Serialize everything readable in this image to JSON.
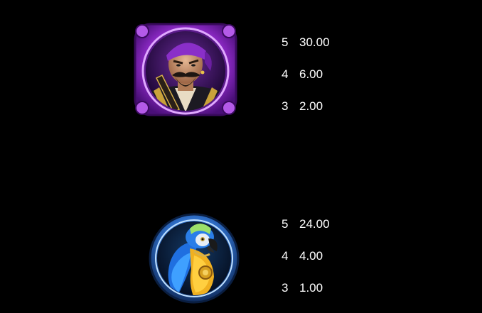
{
  "background_color": "#000000",
  "symbols": [
    {
      "icon": "pirate-icon",
      "frame_color": "#9b2fd6",
      "payouts": [
        {
          "count": "5",
          "value": "30.00"
        },
        {
          "count": "4",
          "value": "6.00"
        },
        {
          "count": "3",
          "value": "2.00"
        }
      ]
    },
    {
      "icon": "parrot-icon",
      "frame_color": "#2f6fc9",
      "payouts": [
        {
          "count": "5",
          "value": "24.00"
        },
        {
          "count": "4",
          "value": "4.00"
        },
        {
          "count": "3",
          "value": "1.00"
        }
      ]
    }
  ]
}
